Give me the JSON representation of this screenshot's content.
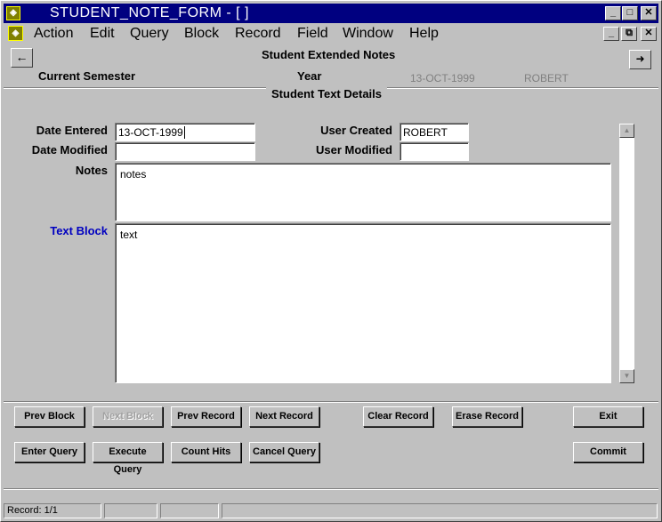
{
  "window": {
    "title": "STUDENT_NOTE_FORM - [ ]",
    "controls": {
      "minimize": "_",
      "maximize": "□",
      "close": "✕",
      "restore": "⧉"
    }
  },
  "menu": {
    "items": [
      {
        "label": "Action"
      },
      {
        "label": "Edit"
      },
      {
        "label": "Query"
      },
      {
        "label": "Block"
      },
      {
        "label": "Record"
      },
      {
        "label": "Field"
      },
      {
        "label": "Window"
      },
      {
        "label": "Help"
      }
    ]
  },
  "header": {
    "title": "Student Extended Notes",
    "semester_label": "Current Semester",
    "year_label": "Year",
    "date_value": "13-OCT-1999",
    "user_value": "ROBERT",
    "back_icon": "←",
    "forward_icon": "➜"
  },
  "section": {
    "title": "Student Text Details"
  },
  "form": {
    "date_entered_label": "Date Entered",
    "date_entered_value": "13-OCT-1999",
    "date_modified_label": "Date Modified",
    "date_modified_value": "",
    "user_created_label": "User Created",
    "user_created_value": "ROBERT",
    "user_modified_label": "User Modified",
    "user_modified_value": "",
    "notes_label": "Notes",
    "notes_value": "notes",
    "text_block_label": "Text Block",
    "text_block_value": "text",
    "text_block_label_color": "#0000c0"
  },
  "buttons": {
    "prev_block": "Prev Block",
    "next_block": "Next Block",
    "prev_record": "Prev Record",
    "next_record": "Next Record",
    "clear_record": "Clear Record",
    "erase_record": "Erase Record",
    "exit": "Exit",
    "enter_query": "Enter Query",
    "execute_query": "Execute Query",
    "count_hits": "Count Hits",
    "cancel_query": "Cancel Query",
    "commit": "Commit"
  },
  "status": {
    "record": "Record: 1/1"
  }
}
